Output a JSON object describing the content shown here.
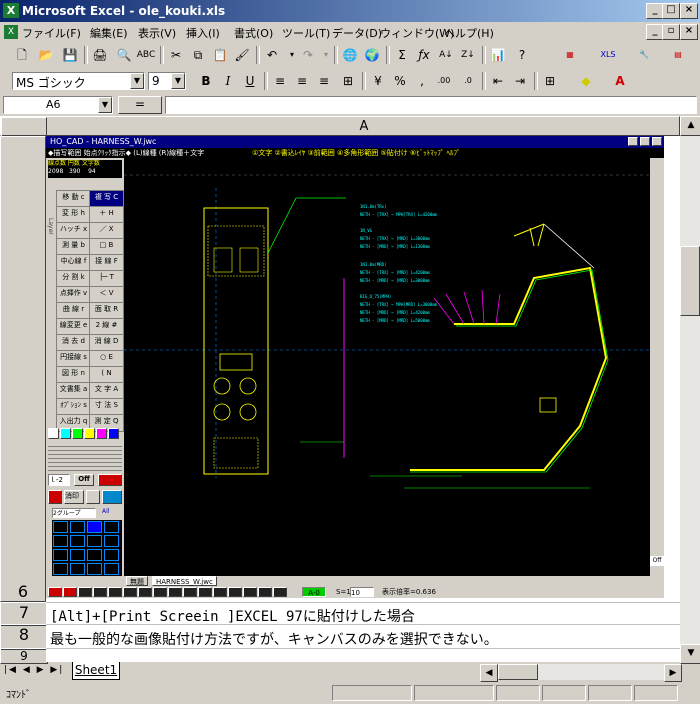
{
  "window": {
    "title": "Microsoft Excel - ole_kouki.xls"
  },
  "menus": [
    "ファイル(F)",
    "編集(E)",
    "表示(V)",
    "挿入(I)",
    "書式(O)",
    "ツール(T)",
    "データ(D)",
    "ウィンドウ(W)",
    "ヘルプ(H)"
  ],
  "format_toolbar": {
    "font": "MS ゴシック",
    "size": "9"
  },
  "name_box": "A6",
  "formula": "",
  "column_header": "A",
  "rows": [
    {
      "num": "6",
      "text": ""
    },
    {
      "num": "7",
      "text": "[Alt]+[Print Screein ]EXCEL 97に貼付けした場合"
    },
    {
      "num": "8",
      "text": "最も一般的な画像貼付け方法ですが、キャンバスのみを選択できない。"
    },
    {
      "num": "9",
      "text": ""
    }
  ],
  "cad": {
    "title": "HO_CAD - HARNESS_W.jwc",
    "menu_left": "◆描写範囲 始点ｸﾘｯｸ指示◆  (L)線種 (R)線種＋文字",
    "menu_right": "①文字 ②書込ﾚｲﾔ ③前範囲 ④多角形範囲 ⑤貼付け ⑥ﾋﾞｯﾄﾏｯﾌﾟ ﾍﾙﾌﾟ",
    "counts_label": "線点数  円数  文字数",
    "counts": [
      "2098",
      "390",
      "94"
    ],
    "tools": [
      [
        "移 動 c",
        "複 写 C"
      ],
      [
        "変 形 h",
        "＋ H"
      ],
      [
        "ハッチ x",
        "／ X"
      ],
      [
        "測 量 b",
        "□ B"
      ],
      [
        "中心線 f",
        "接 線 F"
      ],
      [
        "分 割 k",
        "├─ T"
      ],
      [
        "点挿作 v",
        "＜ V"
      ],
      [
        "曲 線 r",
        "面 取 R"
      ],
      [
        "線変更 e",
        "2 線 #"
      ],
      [
        "消 去 d",
        "消 線 D"
      ],
      [
        "円接線 s",
        "○ E"
      ],
      [
        "図 形 n",
        "( N"
      ],
      [
        "文書集 a",
        "文 字 A"
      ],
      [
        "ｵﾌﾟｼｮﾝ s",
        "寸 法 S"
      ],
      [
        "入出力 q",
        "測 定 Q"
      ]
    ],
    "group_label": "2グループ",
    "group_all": "All",
    "off_label": "Off",
    "tab_left": "無題",
    "tab_right": "HARNESS_W.jwc",
    "status_scale": "S=1:",
    "status_scale_val": "10",
    "status_ratio": "表示倍率=0.636",
    "layer_val": "A-0",
    "corner": "Off",
    "side_labels": [
      "Layer",
      "GroupMat",
      "Cmd"
    ]
  },
  "sheet_tab": "Sheet1",
  "status_text": "ｺﾏﾝﾄﾞ",
  "palette": [
    "#ffffff",
    "#00ffff",
    "#00ff00",
    "#ffff00",
    "#ff00ff",
    "#0000ff"
  ]
}
